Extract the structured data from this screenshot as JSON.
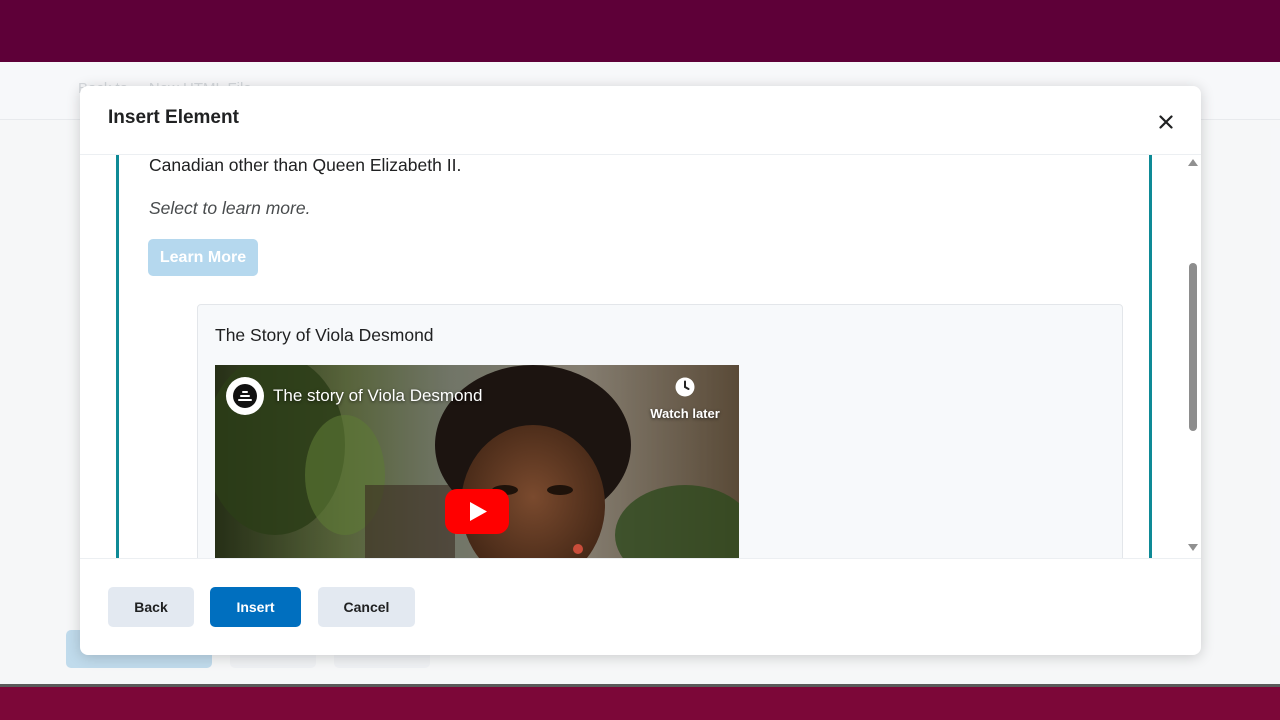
{
  "background": {
    "breadcrumb_text": "Back to ... New HTML File"
  },
  "dialog": {
    "title": "Insert Element",
    "close_icon": "close-icon"
  },
  "content": {
    "body_text": "Canadian other than Queen Elizabeth II.",
    "hint_text": "Select to learn more.",
    "learn_more_label": "Learn More"
  },
  "video": {
    "card_title": "The Story of Viola Desmond",
    "player_title": "The story of Viola Desmond",
    "watch_later_label": "Watch later",
    "channel_icon": "channel-logo-icon",
    "play_icon": "play-icon",
    "clock_icon": "clock-icon"
  },
  "footer": {
    "back_label": "Back",
    "insert_label": "Insert",
    "cancel_label": "Cancel"
  },
  "colors": {
    "brand_band": "#5e0038",
    "accent_teal": "#0e8a96",
    "primary_button": "#006fbf",
    "secondary_button": "#e3e9f1",
    "learn_more_disabled": "#b5d8ee"
  }
}
